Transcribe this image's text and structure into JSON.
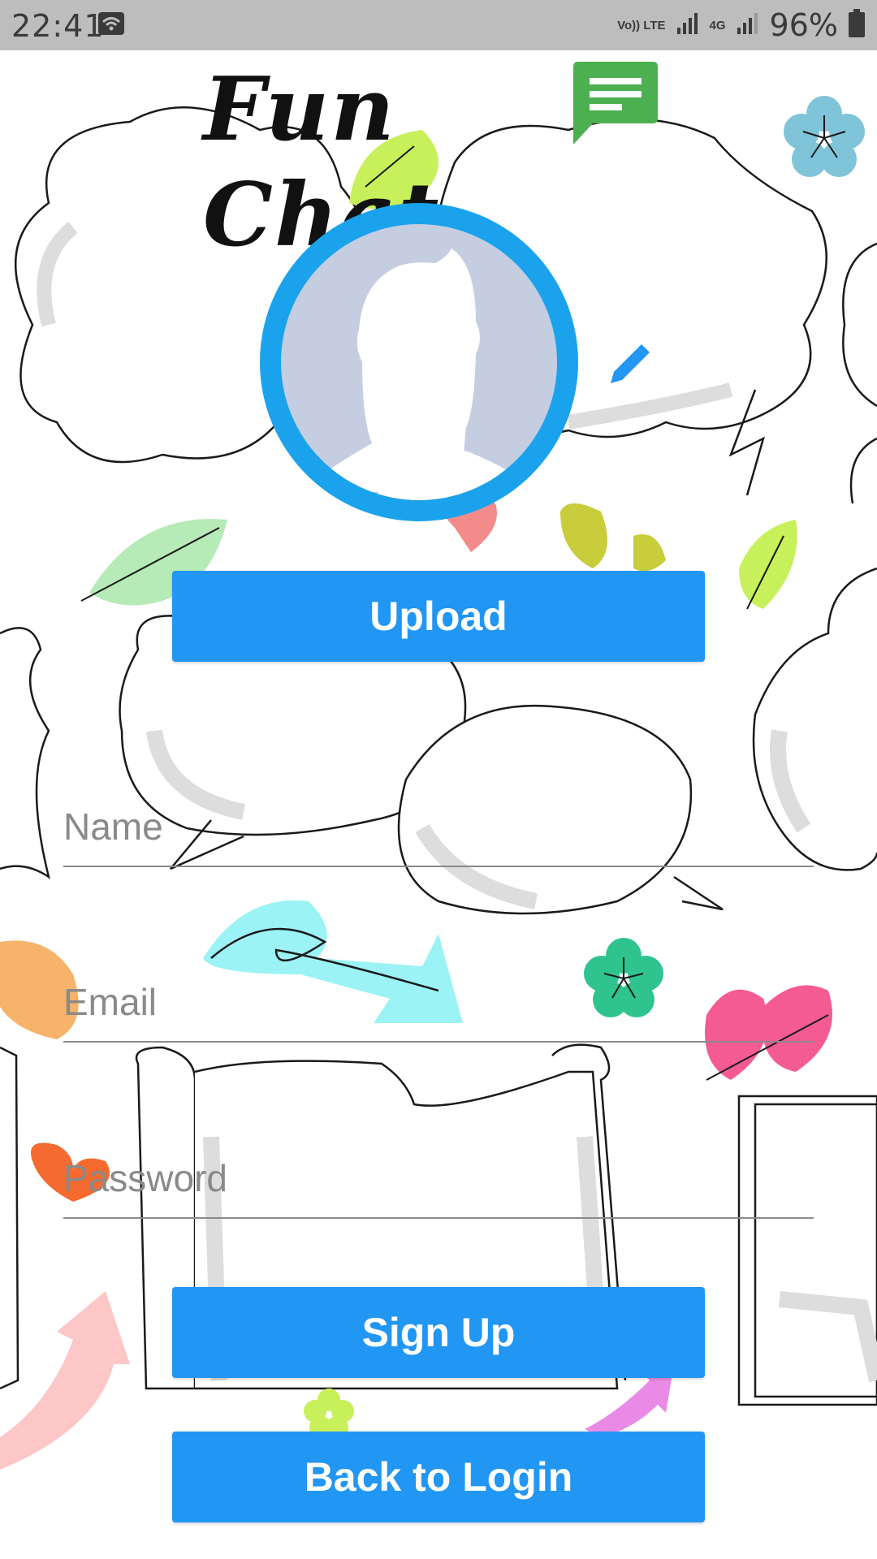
{
  "status_bar": {
    "time": "22:41",
    "network_label": "Vo)) LTE",
    "network_type": "4G",
    "battery": "96%",
    "icons": [
      "wifi-icon",
      "signal-icon",
      "battery-icon"
    ]
  },
  "header": {
    "title": "Fun Chat",
    "logo_icon": "chat-bubble-icon"
  },
  "avatar": {
    "icon": "default-person-icon",
    "edit_icon": "pencil-icon"
  },
  "buttons": {
    "upload": "Upload",
    "sign_up": "Sign Up",
    "back_to_login": "Back to Login"
  },
  "form": {
    "name_placeholder": "Name",
    "email_placeholder": "Email",
    "password_placeholder": "Password"
  },
  "colors": {
    "accent": "#2196f3",
    "avatar_ring": "#1aa3ec",
    "logo_green": "#4caf50",
    "status_bar": "#bdbdbd"
  }
}
